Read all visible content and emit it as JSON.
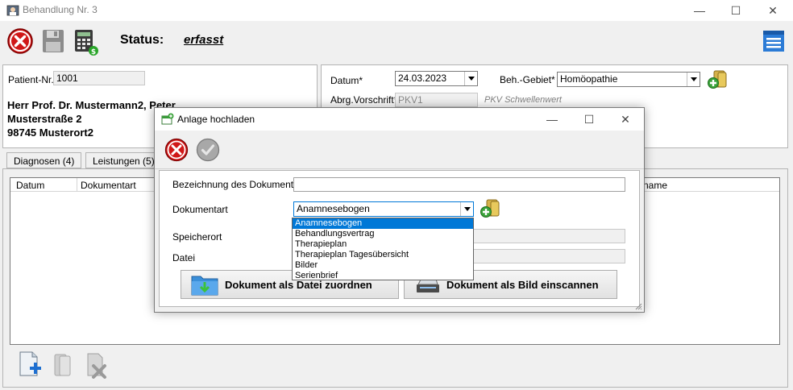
{
  "window": {
    "title": "Behandlung Nr. 3",
    "caption": {
      "minimize": "—",
      "maximize": "☐",
      "close": "✕"
    }
  },
  "toolbar": {
    "status_label": "Status:",
    "status_value": "erfasst",
    "icons": [
      "cancel-icon",
      "save-icon",
      "calculator-icon",
      "list-menu-icon"
    ]
  },
  "patient": {
    "nr_label": "Patient-Nr.",
    "nr_value": "1001",
    "name": "Herr Prof. Dr. Mustermann2, Peter",
    "street": "Musterstraße 2",
    "city": "98745 Musterort2"
  },
  "case": {
    "date_label": "Datum*",
    "date_value": "24.03.2023",
    "area_label": "Beh.-Gebiet*",
    "area_value": "Homöopathie",
    "billing_label": "Abrg.Vorschrift*",
    "billing_value": "PKV1",
    "billing_note": "PKV Schwellenwert"
  },
  "tabs": [
    {
      "label": "Diagnosen (4)"
    },
    {
      "label": "Leistungen (5)"
    }
  ],
  "grid": {
    "columns": [
      "Datum",
      "Dokumentart",
      "name"
    ]
  },
  "dialog": {
    "title": "Anlage hochladen",
    "caption": {
      "minimize": "—",
      "maximize": "☐",
      "close": "✕"
    },
    "fields": {
      "name_label": "Bezeichnung des Dokuments",
      "name_value": "",
      "type_label": "Dokumentart",
      "type_value": "Anamnesebogen",
      "location_label": "Speicherort",
      "file_label": "Datei"
    },
    "dropdown_options": [
      "Anamnesebogen",
      "Behandlungsvertrag",
      "Therapieplan",
      "Therapieplan Tagesübersicht",
      "Bilder",
      "Serienbrief"
    ],
    "buttons": {
      "assign_file": "Dokument als Datei zuordnen",
      "scan_image": "Dokument als Bild einscannen"
    }
  }
}
